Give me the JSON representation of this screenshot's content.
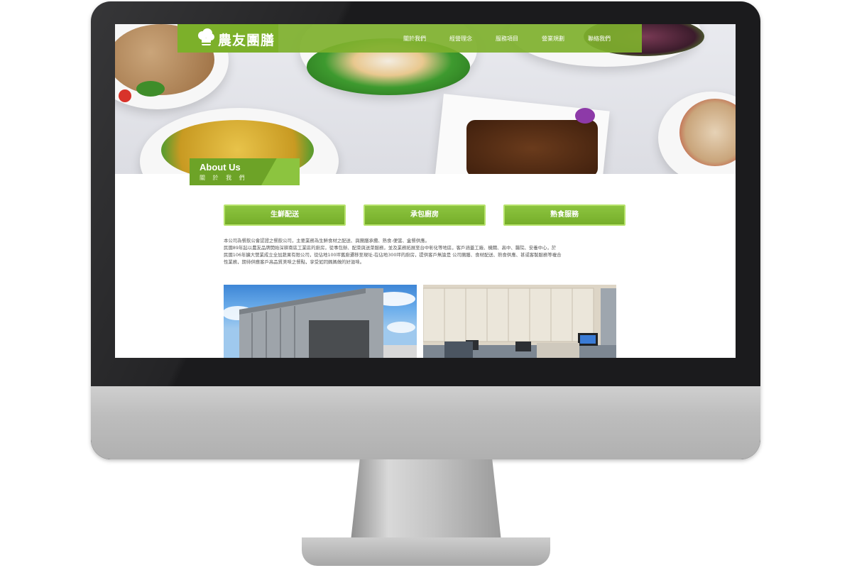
{
  "site": {
    "logo_text": "農友團膳"
  },
  "nav": [
    {
      "label": "關於我們"
    },
    {
      "label": "經營理念"
    },
    {
      "label": "服務項目"
    },
    {
      "label": "營業規劃"
    },
    {
      "label": "聯絡我們"
    }
  ],
  "section": {
    "title_en": "About Us",
    "title_zh": "關 於 我 們"
  },
  "services": [
    {
      "label": "生鮮配送"
    },
    {
      "label": "承包廚房"
    },
    {
      "label": "熟食服務"
    }
  ],
  "intro": {
    "line1": "本公司為餐飲公會認證之餐飲公司，主要業務為生鮮食材之配送、與團膳承攬、熟食-便當、盒餐供應。",
    "line2": "民國89年起以農友品牌開始深耕南區工業區的廚房，從事包辦、配菜與送菜服務，並及業務拓展至台中彰化等地區，客戶涵蓋工廠、機關、高中、醫院、安養中心，於",
    "line3": "民國106年擴大營業成立全加蔬果有限公司，從佔地100坪舊廚遷移至現址-在佔地300坪的廚房，提供客戶無論是 公司團膳、食材配送、熟食供應、甚或客製服務等複合",
    "line4": "性業務，期待供應客戶高品質美味之餐點，享受如同媽媽做的好滋味。"
  },
  "colors": {
    "brand_green": "#7cb02a",
    "button_border": "#b7e36c",
    "monitor_bezel": "#1b1b1d",
    "monitor_chin": "#bdbdbd"
  },
  "icons": {
    "logo": "chef-hat-icon"
  }
}
